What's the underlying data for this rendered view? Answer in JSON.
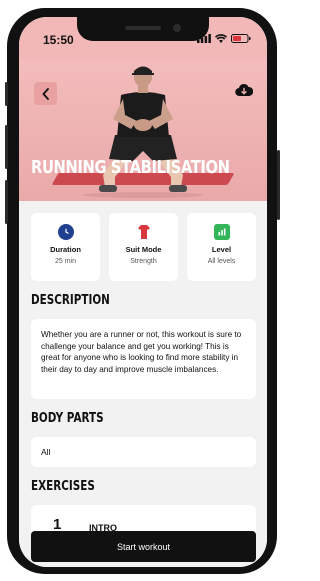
{
  "status_bar": {
    "time": "15:50"
  },
  "hero": {
    "title": "RUNNING STABILISATION"
  },
  "stats": [
    {
      "label": "Duration",
      "value": "25 min",
      "icon": "clock-icon",
      "color": "#1f3f8f"
    },
    {
      "label": "Suit Mode",
      "value": "Strength",
      "icon": "shirt-icon",
      "color": "#d9363e"
    },
    {
      "label": "Level",
      "value": "All levels",
      "icon": "bar-chart-icon",
      "color": "#33b55a"
    }
  ],
  "description": {
    "title": "DESCRIPTION",
    "text": "Whether you are a runner or not, this workout is sure to challenge your balance and get you working! This is great for anyone who is looking to find more stability in their day to day and improve muscle imbalances."
  },
  "body_parts": {
    "title": "BODY PARTS",
    "value": "All"
  },
  "exercises": {
    "title": "EXERCISES",
    "items": [
      {
        "number": "1",
        "name": "INTRO"
      }
    ]
  },
  "start_button": "Start workout"
}
